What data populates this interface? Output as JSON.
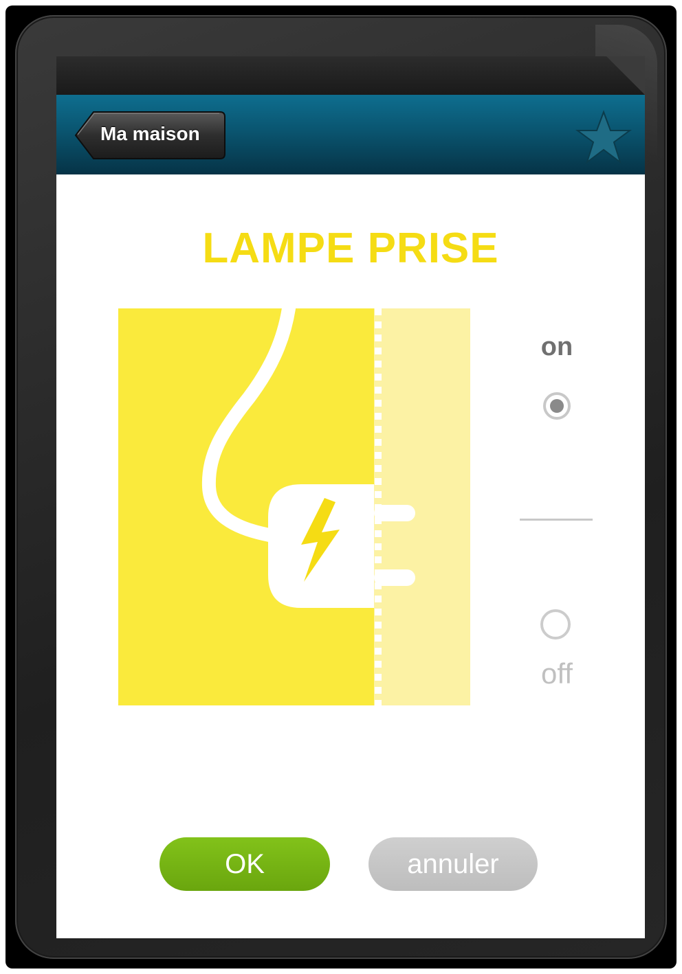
{
  "navbar": {
    "back_label": "Ma maison",
    "favorite_icon": "star-icon"
  },
  "device": {
    "title": "LAMPE PRISE",
    "illustration_icon": "plug-lightning-icon"
  },
  "toggle": {
    "on_label": "on",
    "off_label": "off",
    "selected": "on"
  },
  "actions": {
    "ok_label": "OK",
    "cancel_label": "annuler"
  },
  "colors": {
    "accent_yellow": "#f5dc14",
    "navbar_teal": "#0a5570",
    "ok_green": "#7ab516",
    "cancel_gray": "#c4c4c4"
  }
}
